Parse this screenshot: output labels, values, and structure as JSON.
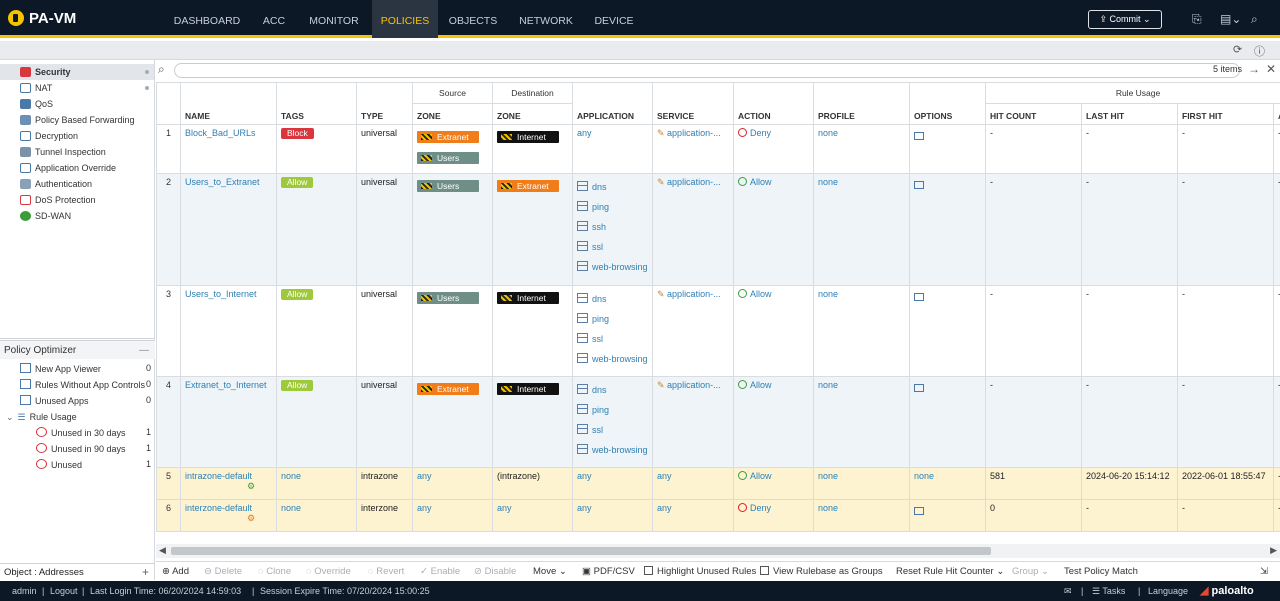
{
  "app": {
    "title": "PA-VM"
  },
  "nav": [
    {
      "label": "DASHBOARD"
    },
    {
      "label": "ACC"
    },
    {
      "label": "MONITOR"
    },
    {
      "label": "POLICIES"
    },
    {
      "label": "OBJECTS"
    },
    {
      "label": "NETWORK"
    },
    {
      "label": "DEVICE"
    }
  ],
  "header": {
    "commit_label": "Commit"
  },
  "sidebar": {
    "items": [
      {
        "label": "Security"
      },
      {
        "label": "NAT"
      },
      {
        "label": "QoS"
      },
      {
        "label": "Policy Based Forwarding"
      },
      {
        "label": "Decryption"
      },
      {
        "label": "Tunnel Inspection"
      },
      {
        "label": "Application Override"
      },
      {
        "label": "Authentication"
      },
      {
        "label": "DoS Protection"
      },
      {
        "label": "SD-WAN"
      }
    ]
  },
  "optimizer": {
    "title": "Policy Optimizer",
    "items": [
      {
        "label": "New App Viewer",
        "count": "0"
      },
      {
        "label": "Rules Without App Controls",
        "count": "0"
      },
      {
        "label": "Unused Apps",
        "count": "0"
      },
      {
        "label": "Rule Usage",
        "count": ""
      },
      {
        "label": "Unused in 30 days",
        "count": "1"
      },
      {
        "label": "Unused in 90 days",
        "count": "1"
      },
      {
        "label": "Unused",
        "count": "1"
      }
    ]
  },
  "object_bar": {
    "label": "Object : Addresses"
  },
  "search": {
    "items_count": "5 items"
  },
  "table": {
    "groups": {
      "source": "Source",
      "destination": "Destination",
      "rule_usage": "Rule Usage"
    },
    "columns": [
      "NAME",
      "TAGS",
      "TYPE",
      "ZONE",
      "ZONE",
      "APPLICATION",
      "SERVICE",
      "ACTION",
      "PROFILE",
      "OPTIONS",
      "HIT COUNT",
      "LAST HIT",
      "FIRST HIT",
      "A"
    ],
    "rows": [
      {
        "num": "1",
        "name": "Block_Bad_URLs",
        "tag": "Block",
        "type": "universal",
        "src": [
          "Extranet",
          "Users"
        ],
        "dst": [
          "Internet"
        ],
        "apps": [
          "any"
        ],
        "service": "application-...",
        "action": "Deny",
        "profile": "none",
        "options": "",
        "hit": "-",
        "last": "-",
        "first": "-",
        "extra": "-"
      },
      {
        "num": "2",
        "name": "Users_to_Extranet",
        "tag": "Allow",
        "type": "universal",
        "src": [
          "Users"
        ],
        "dst": [
          "Extranet"
        ],
        "apps": [
          "dns",
          "ping",
          "ssh",
          "ssl",
          "web-browsing"
        ],
        "service": "application-...",
        "action": "Allow",
        "profile": "none",
        "options": "",
        "hit": "-",
        "last": "-",
        "first": "-",
        "extra": "-"
      },
      {
        "num": "3",
        "name": "Users_to_Internet",
        "tag": "Allow",
        "type": "universal",
        "src": [
          "Users"
        ],
        "dst": [
          "Internet"
        ],
        "apps": [
          "dns",
          "ping",
          "ssl",
          "web-browsing"
        ],
        "service": "application-...",
        "action": "Allow",
        "profile": "none",
        "options": "",
        "hit": "-",
        "last": "-",
        "first": "-",
        "extra": "-"
      },
      {
        "num": "4",
        "name": "Extranet_to_Internet",
        "tag": "Allow",
        "type": "universal",
        "src": [
          "Extranet"
        ],
        "dst": [
          "Internet"
        ],
        "apps": [
          "dns",
          "ping",
          "ssl",
          "web-browsing"
        ],
        "service": "application-...",
        "action": "Allow",
        "profile": "none",
        "options": "",
        "hit": "-",
        "last": "-",
        "first": "-",
        "extra": "-"
      },
      {
        "num": "5",
        "name": "intrazone-default",
        "tag": "none",
        "type": "intrazone",
        "src": [
          "any"
        ],
        "dst": [
          "(intrazone)"
        ],
        "apps": [
          "any"
        ],
        "service": "any",
        "action": "Allow",
        "profile": "none",
        "options": "none",
        "hit": "581",
        "last": "2024-06-20 15:14:12",
        "first": "2022-06-01 18:55:47",
        "extra": "-"
      },
      {
        "num": "6",
        "name": "interzone-default",
        "tag": "none",
        "type": "interzone",
        "src": [
          "any"
        ],
        "dst": [
          "any"
        ],
        "apps": [
          "any"
        ],
        "service": "any",
        "action": "Deny",
        "profile": "none",
        "options": "",
        "hit": "0",
        "last": "-",
        "first": "-",
        "extra": "-"
      }
    ]
  },
  "toolbar": {
    "add": "Add",
    "delete": "Delete",
    "clone": "Clone",
    "override": "Override",
    "revert": "Revert",
    "enable": "Enable",
    "disable": "Disable",
    "move": "Move",
    "pdfcsv": "PDF/CSV",
    "highlight": "Highlight Unused Rules",
    "view_groups": "View Rulebase as Groups",
    "reset": "Reset Rule Hit Counter",
    "group": "Group",
    "test": "Test Policy Match"
  },
  "status": {
    "user": "admin",
    "logout": "Logout",
    "last_login": "Last Login Time: 06/20/2024 14:59:03",
    "session": "Session Expire Time: 07/20/2024 15:00:25",
    "tasks": "Tasks",
    "language": "Language",
    "brand": "paloalto"
  },
  "colors": {
    "accent": "#f5c300",
    "header_bg": "#0c1826",
    "link": "#2e7fb5",
    "tag_block": "#d9363e",
    "tag_allow": "#9fc93c",
    "zone_extranet": "#f07d1a",
    "zone_users": "#6f8f86",
    "zone_internet": "#111111"
  }
}
